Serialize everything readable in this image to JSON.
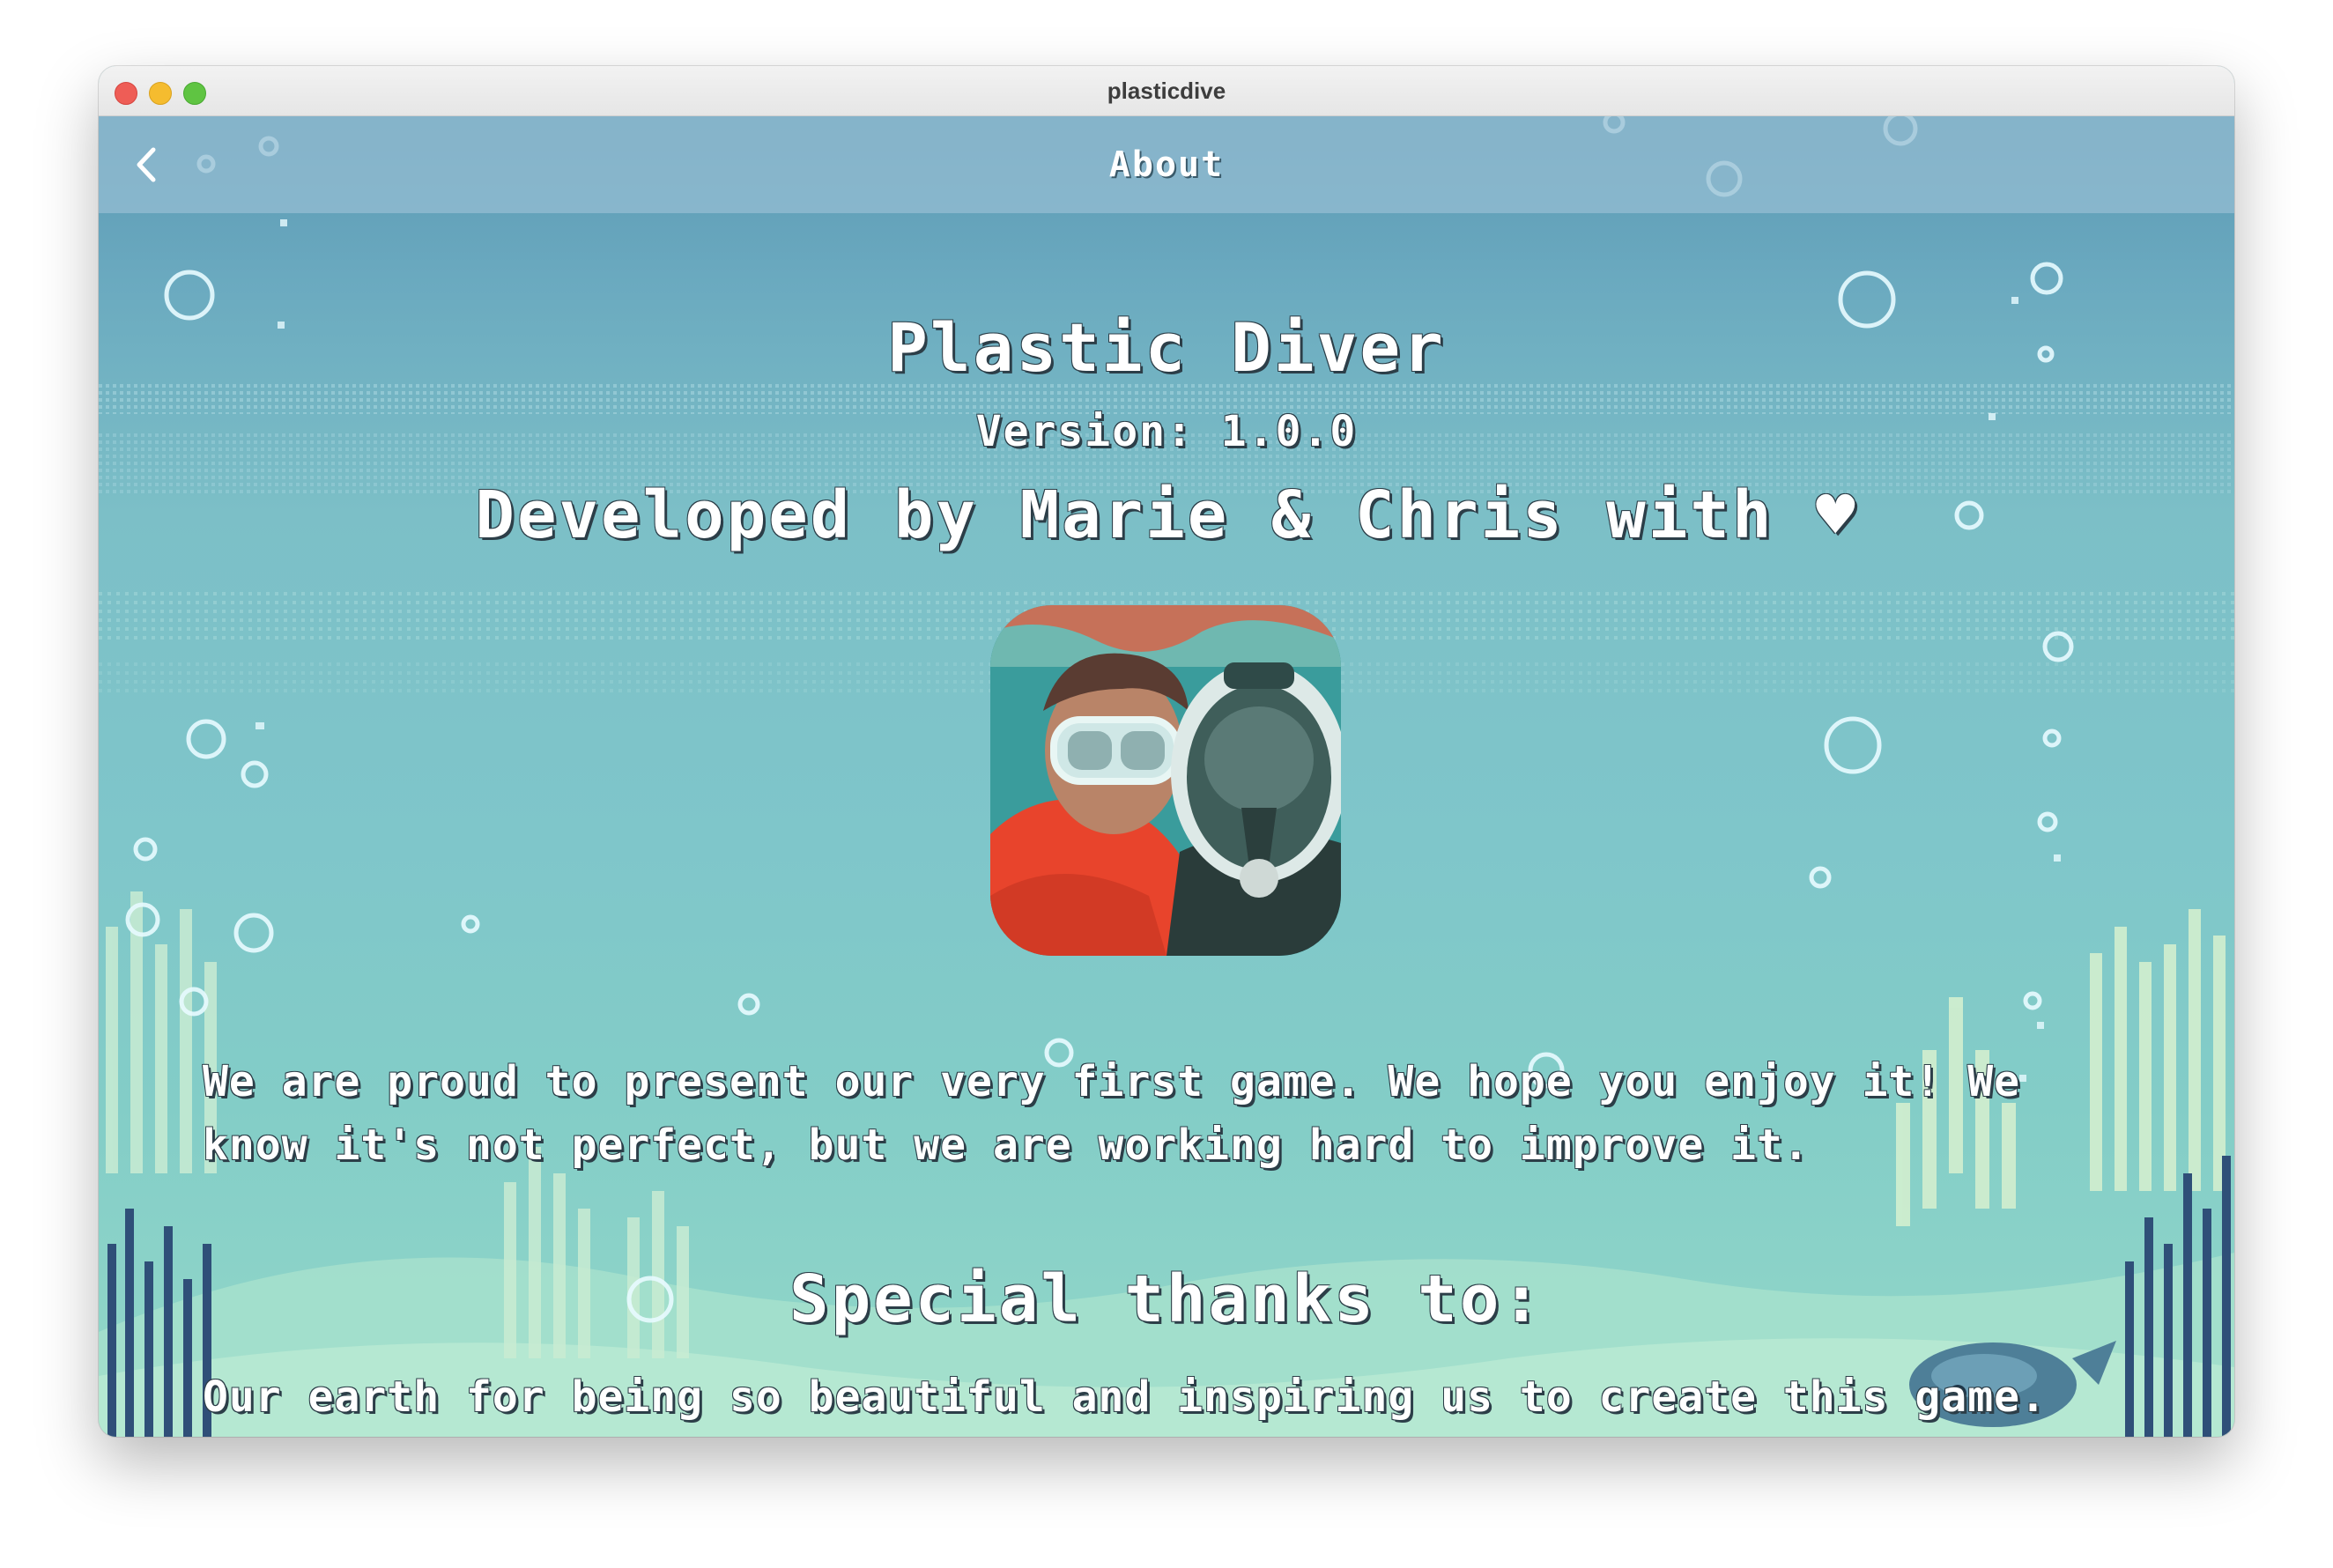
{
  "window": {
    "title": "plasticdive"
  },
  "nav": {
    "back_icon": "chevron-left-icon",
    "title": "About"
  },
  "about": {
    "app_name": "Plastic Diver",
    "version": "Version: 1.0.0",
    "developed_by": "Developed by Marie & Chris with ♥",
    "photo_description_icon": "developers-photo",
    "intro_text": "We are proud to present our very first game. We hope you enjoy it! We know it's not perfect, but we are working hard to improve it.",
    "thanks_heading": "Special thanks to:",
    "thanks_text": "Our earth for being so beautiful and inspiring us to create this game. Let's not forget to protect it!"
  },
  "colors": {
    "text": "#ffffff",
    "text_outline": "#2c3e48",
    "water_top": "#5b98b3",
    "water_bottom": "#93d8c9",
    "navbar": "#96bed2"
  }
}
